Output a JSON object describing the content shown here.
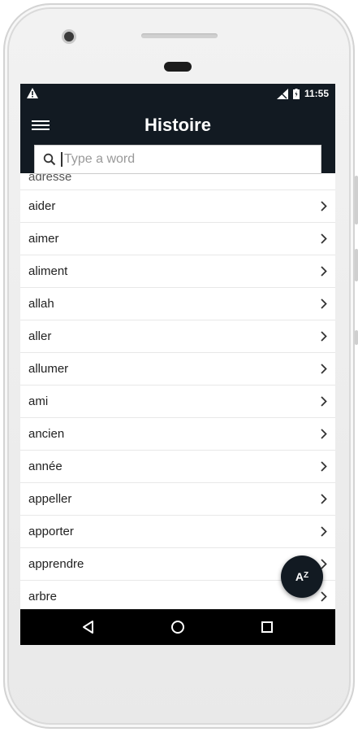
{
  "status_bar": {
    "time": "11:55"
  },
  "app_bar": {
    "title": "Histoire",
    "menu_icon": "hamburger-menu-icon"
  },
  "search": {
    "placeholder": "Type a word",
    "icon": "search-icon"
  },
  "list": {
    "partial_item": "adresse",
    "items": [
      {
        "word": "aider"
      },
      {
        "word": "aimer"
      },
      {
        "word": "aliment"
      },
      {
        "word": "allah"
      },
      {
        "word": "aller"
      },
      {
        "word": "allumer"
      },
      {
        "word": "ami"
      },
      {
        "word": "ancien"
      },
      {
        "word": "année"
      },
      {
        "word": "appeller"
      },
      {
        "word": "apporter"
      },
      {
        "word": "apprendre"
      },
      {
        "word": "arbre"
      }
    ]
  },
  "fab": {
    "label_main": "A",
    "label_small": "Z",
    "icon": "sort-az-icon"
  },
  "nav_bar": {
    "back_icon": "back-triangle-icon",
    "home_icon": "home-circle-icon",
    "recents_icon": "recents-square-icon"
  },
  "colors": {
    "primary_dark": "#121a22",
    "divider": "#e8e8e8"
  }
}
